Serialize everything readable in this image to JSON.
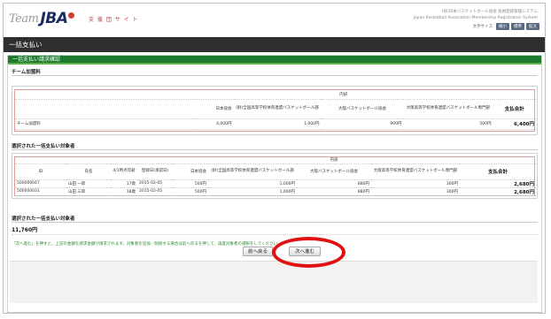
{
  "header": {
    "logo_team": "Team",
    "logo_jba": "JBA",
    "site_name": "支 援 団 サ イ ト",
    "org_line1": "(財)日本バスケットボール協会 会員登録管理システム",
    "org_line2": "Japan Basketball Association Membership Registration System",
    "util_label": "文字サイズ",
    "util_buttons": [
      "縮小",
      "標準",
      "拡大"
    ]
  },
  "title_bar": "一括支払い",
  "section_bar": "一括支払い請求確認",
  "team_fee": {
    "heading": "チーム加盟料",
    "group_label": "内訳",
    "columns": [
      "日本協会",
      "(財)全国高等学校体育連盟バスケットボール部",
      "大阪バスケットボール協会",
      "大阪高等学校体育連盟バスケットボール専門部",
      "支払合計"
    ],
    "row": {
      "label": "チーム加盟料",
      "values": [
        "4,000円",
        "1,000円",
        "900円",
        "500円",
        "6,400円"
      ]
    }
  },
  "members": {
    "heading": "選択された一括支払い対象者",
    "group_label": "内訳",
    "columns": [
      "ID",
      "氏名",
      "4/1時点年齢",
      "登録日(承認日)",
      "日本協会",
      "(財)全国高等学校体育連盟バスケットボール部",
      "大阪バスケットボール協会",
      "大阪高等学校体育連盟バスケットボール専門部",
      "支払合計"
    ],
    "rows": [
      [
        "500000047",
        "山田 一郎",
        "17歳",
        "2015-02-05",
        "500円",
        "1,000円",
        "880円",
        "300円",
        "2,680円"
      ],
      [
        "500000031",
        "山田 三郎",
        "18歳",
        "2015-02-05",
        "500円",
        "1,000円",
        "880円",
        "300円",
        "2,680円"
      ]
    ]
  },
  "total": {
    "heading": "選択された一括支払い対象者",
    "amount": "11,760円"
  },
  "note": "「次へ進む」を押すと、上記の金額を請求金額が請求されます。対象者を追加／削除する場合は前へ戻るを押して、再度対象者の選択をしてください。",
  "buttons": {
    "back": "前へ戻る",
    "next": "次へ進む"
  }
}
